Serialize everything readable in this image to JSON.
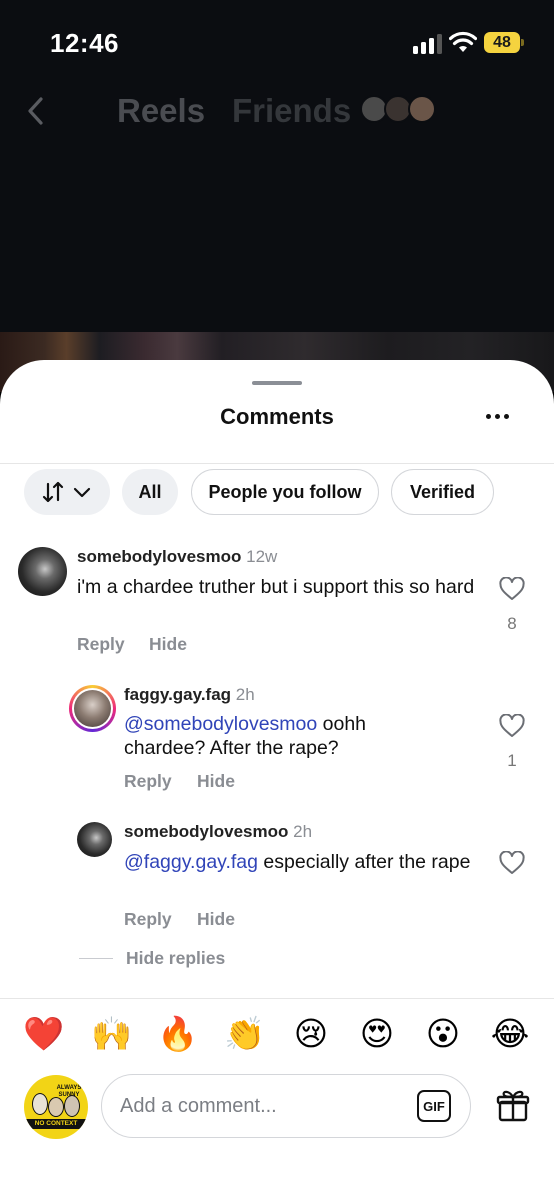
{
  "status_bar": {
    "time": "12:46",
    "battery": "48"
  },
  "top_nav": {
    "tabs": [
      {
        "label": "Reels"
      },
      {
        "label": "Friends"
      }
    ]
  },
  "sheet": {
    "title": "Comments"
  },
  "filters": {
    "items": [
      {
        "label": "All"
      },
      {
        "label": "People you follow"
      },
      {
        "label": "Verified"
      }
    ]
  },
  "comments": [
    {
      "username": "somebodylovesmoo",
      "time": "12w",
      "mention": "",
      "text": "i'm a chardee truther but i support this so hard",
      "likes": "8",
      "reply_label": "Reply",
      "hide_label": "Hide"
    },
    {
      "username": "faggy.gay.fag",
      "time": "2h",
      "mention": "@somebodylovesmoo",
      "text": " oohh chardee? After the rape?",
      "likes": "1",
      "reply_label": "Reply",
      "hide_label": "Hide"
    },
    {
      "username": "somebodylovesmoo",
      "time": "2h",
      "mention": "@faggy.gay.fag",
      "text": " especially after the rape",
      "likes": "",
      "reply_label": "Reply",
      "hide_label": "Hide"
    }
  ],
  "hide_replies": "Hide replies",
  "emoji_bar": [
    "❤️",
    "🙌",
    "🔥",
    "👏",
    "😢",
    "😍",
    "😮",
    "😂"
  ],
  "composer": {
    "placeholder": "Add a comment...",
    "gif_label": "GIF",
    "avatar_text_top": "ALWAYS SUNNY",
    "avatar_text_bottom": "NO CONTEXT"
  },
  "icons": {
    "back": "chevron-left-icon",
    "sort": "sort-arrows-icon",
    "more": "more-horizontal-icon",
    "like": "heart-icon",
    "gift": "gift-icon"
  },
  "colors": {
    "mention": "#3044b8",
    "battery": "#f5d33f",
    "accent_avatar_ring": "#e1306c"
  }
}
